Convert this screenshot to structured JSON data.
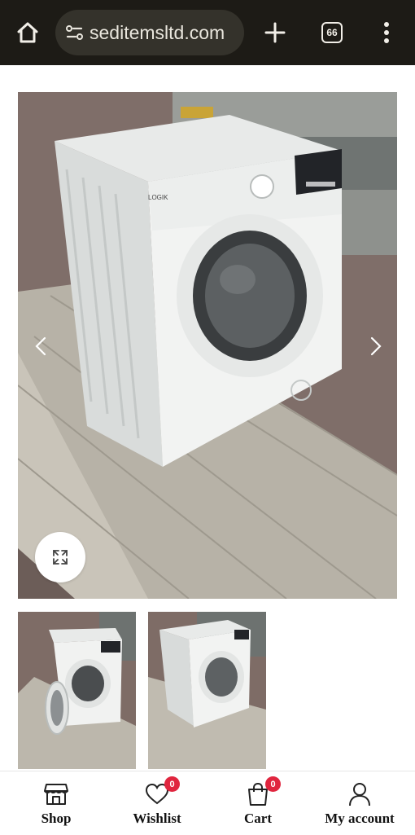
{
  "browser": {
    "url": "seditemsltd.com",
    "tab_count": "66",
    "icons": [
      "home-icon",
      "site-settings-icon",
      "new-tab-icon",
      "tabs-icon",
      "more-icon"
    ]
  },
  "gallery": {
    "main_image": {
      "brand": "LOGIK",
      "description_icons": [
        "chevron-left-icon",
        "chevron-right-icon",
        "expand-icon"
      ]
    },
    "thumbnails": [
      {
        "label": "washing-machine-door-open"
      },
      {
        "label": "washing-machine-side"
      }
    ]
  },
  "bottom_nav": {
    "items": [
      {
        "label": "Shop",
        "icon": "shop-icon"
      },
      {
        "label": "Wishlist",
        "icon": "heart-icon",
        "badge": "0"
      },
      {
        "label": "Cart",
        "icon": "bag-icon",
        "badge": "0"
      },
      {
        "label": "My account",
        "icon": "user-icon"
      }
    ],
    "badge_color": "#e0253e"
  },
  "colors": {
    "browser_bar": "#1d1b16",
    "url_pill": "#34322b"
  }
}
